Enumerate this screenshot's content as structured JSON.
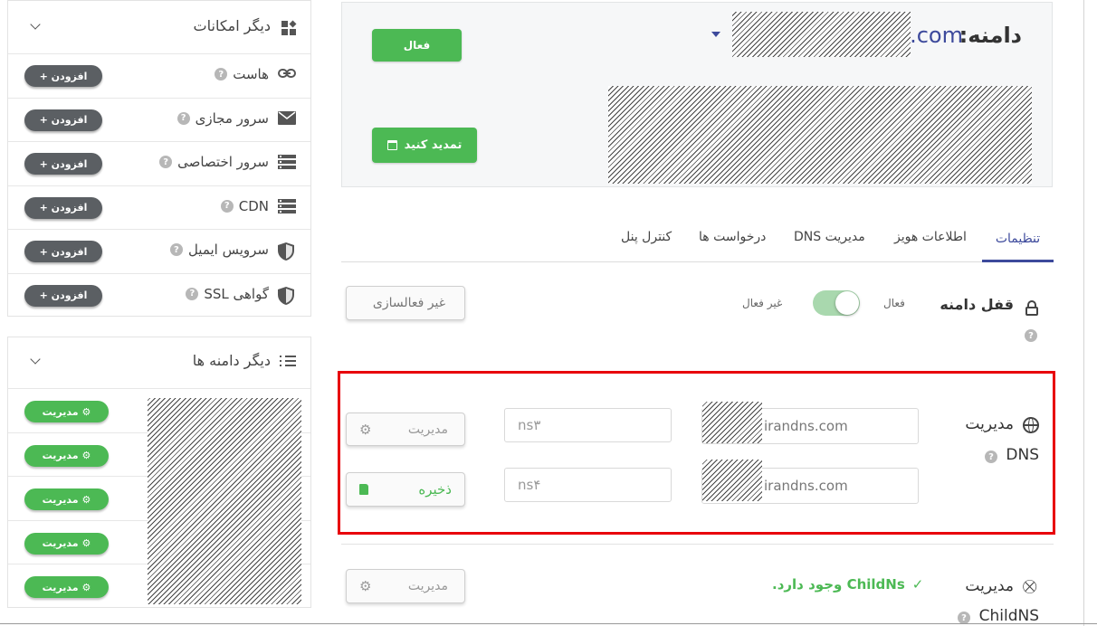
{
  "domain": {
    "label": "دامنه:",
    "suffix": ".com",
    "status_button": "فعال",
    "renew_button": "تمدید کنید"
  },
  "tabs": [
    {
      "label": "تنظیمات",
      "active": true
    },
    {
      "label": "اطلاعات هویز",
      "active": false
    },
    {
      "label": "مدیریت DNS",
      "active": false
    },
    {
      "label": "درخواست ها",
      "active": false
    },
    {
      "label": "کنترل پنل",
      "active": false
    }
  ],
  "lock": {
    "title": "قفل دامنه",
    "on_label": "فعال",
    "off_label": "غیر فعال",
    "toggle_on": true,
    "deactivate_button": "غیر فعالسازی"
  },
  "dns": {
    "title_line1": "مدیریت",
    "title_line2": "DNS",
    "ns1_value": "irandns.com",
    "ns2_value": "irandns.com",
    "ns3_placeholder": "ns۳",
    "ns4_placeholder": "ns۴",
    "manage_button": "مدیریت",
    "save_button": "ذخیره"
  },
  "childns": {
    "title_line1": "مدیریت",
    "title_line2": "ChildNS",
    "status": "ChildNs وجود دارد.",
    "manage_button": "مدیریت"
  },
  "features_panel": {
    "title": "دیگر امکانات",
    "add_label": "+ افزودن",
    "items": [
      {
        "label": "هاست",
        "icon": "link-icon"
      },
      {
        "label": "سرور مجازی",
        "icon": "envelope-icon"
      },
      {
        "label": "سرور اختصاصی",
        "icon": "server-icon"
      },
      {
        "label": "CDN",
        "icon": "server-icon"
      },
      {
        "label": "سرویس ایمیل",
        "icon": "shield-icon"
      },
      {
        "label": "گواهی SSL",
        "icon": "shield-icon"
      }
    ]
  },
  "domains_panel": {
    "title": "دیگر دامنه ها",
    "manage_label": "مدیریت",
    "row_count_label": [
      "مدیریت",
      "مدیریت",
      "مدیریت",
      "مدیریت",
      "مدیریت"
    ]
  },
  "colors": {
    "green": "#4cb954",
    "dark_pill": "#5b5f63",
    "highlight": "#e8000b",
    "link_blue": "#3d4a9c"
  }
}
